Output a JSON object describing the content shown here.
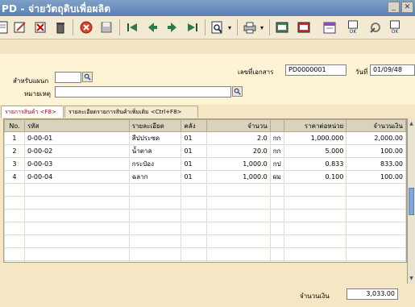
{
  "window": {
    "title": "PD - จ่ายวัตถุดิบเพื่อผลิต"
  },
  "toolbar": {
    "icons": [
      "new-icon",
      "edit-icon",
      "delete-icon",
      "print-icon",
      "cancel-icon",
      "save-icon",
      "first-icon",
      "prev-icon",
      "next-icon",
      "last-icon",
      "search-icon",
      "dropdown-icon",
      "printer-icon",
      "dropdown-icon",
      "export-icon",
      "report-icon",
      "calendar-icon",
      "ok-icon",
      "tools-icon",
      "ok-icon"
    ],
    "ok_label": "OK"
  },
  "header": {
    "doc_no_label": "เลขที่เอกสาร",
    "doc_no_value": "PD0000001",
    "date_label": "วันที่",
    "date_value": "01/09/48",
    "dept_label": "สำหรับแผนก",
    "dept_value": "",
    "remark_label": "หมายเหตุ",
    "remark_value": ""
  },
  "tabs": [
    {
      "label": "รายการสินค้า <F8>",
      "active": true
    },
    {
      "label": "รายละเอียดรายการสินค้าเพิ่มเติม <Ctrl+F8>",
      "active": false
    }
  ],
  "table": {
    "columns": [
      "No.",
      "รหัส",
      "รายละเอียด",
      "คลัง",
      "จำนวน",
      "",
      "ราคาต่อหน่วย",
      "จำนวนเงิน"
    ],
    "rows": [
      [
        "1",
        "0-00-01",
        "สีปประซด",
        "01",
        "2.0",
        "กก",
        "1,000.000",
        "2,000.00"
      ],
      [
        "2",
        "0-00-02",
        "น้ำตาล",
        "01",
        "20.0",
        "กก",
        "5.000",
        "100.00"
      ],
      [
        "3",
        "0-00-03",
        "กระป๋อง",
        "01",
        "1,000.0",
        "กป",
        "0.833",
        "833.00"
      ],
      [
        "4",
        "0-00-04",
        "ฉลาก",
        "01",
        "1,000.0",
        "ผม",
        "0.100",
        "100.00"
      ]
    ]
  },
  "footer": {
    "total_label": "จำนวนเงิน",
    "total_value": "3,033.00"
  }
}
